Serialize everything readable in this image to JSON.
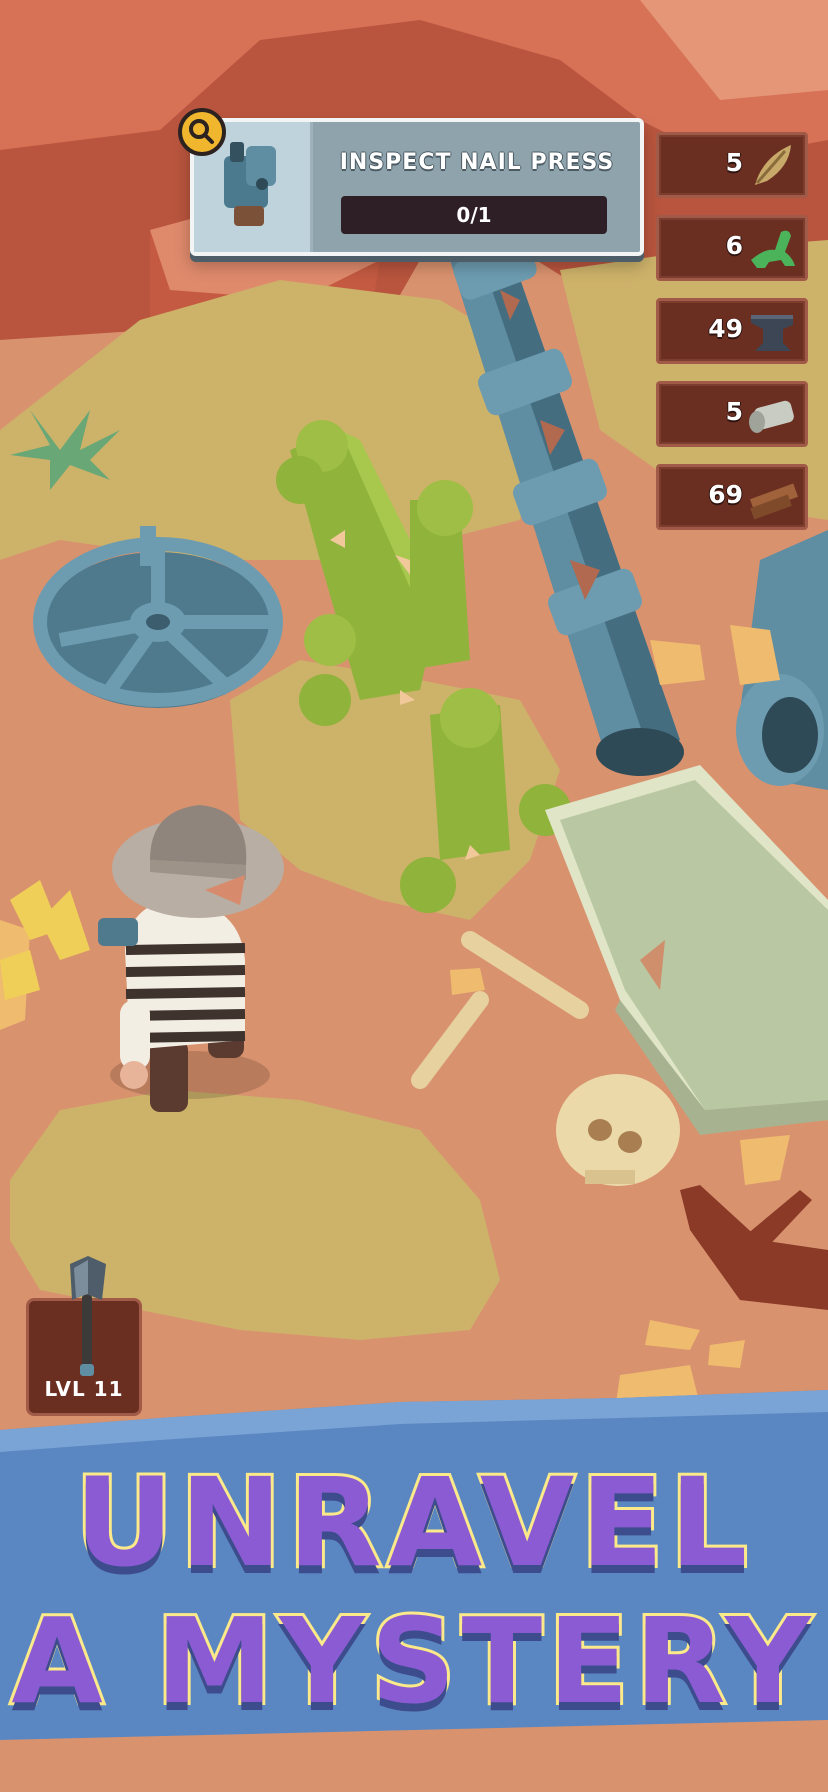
{
  "quest": {
    "title": "INSPECT NAIL PRESS",
    "progress": "0/1",
    "badge_icon": "magnifier-icon",
    "thumb_icon": "nail-press-icon"
  },
  "resources": [
    {
      "count": "5",
      "icon": "feather-leaf-icon"
    },
    {
      "count": "6",
      "icon": "green-dinosaur-icon"
    },
    {
      "count": "49",
      "icon": "anvil-icon"
    },
    {
      "count": "5",
      "icon": "metal-can-icon"
    },
    {
      "count": "69",
      "icon": "wood-plank-icon"
    }
  ],
  "tool": {
    "level": "LVL 11",
    "icon": "axe-icon"
  },
  "banner": {
    "line1": "UNRAVEL",
    "line2": "A MYSTERY"
  },
  "colors": {
    "sand": "#d9926e",
    "cliff": "#c96147",
    "grass_patch": "#cdb26a",
    "pipe": "#5f8da1",
    "cactus": "#8fb33b",
    "banner_blue": "#5a87c2",
    "title_purple": "#8b5bd3",
    "title_outline": "#fbe98a",
    "panel_brown": "#6b2f22"
  }
}
